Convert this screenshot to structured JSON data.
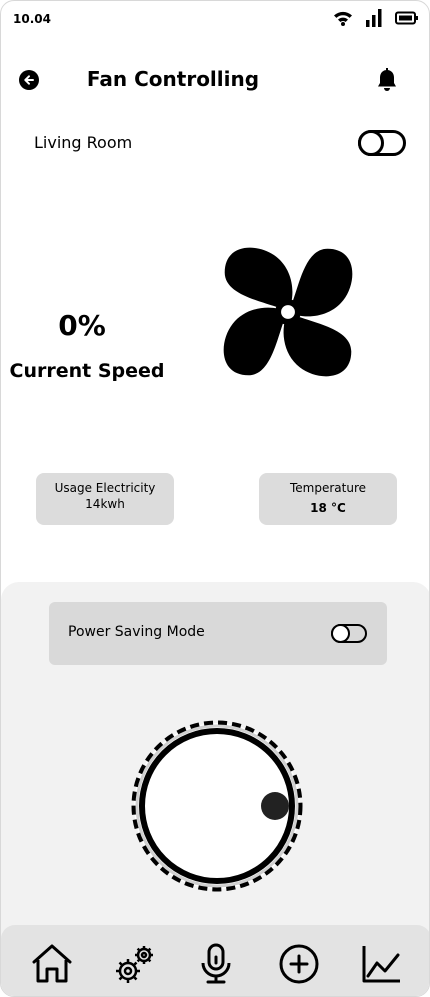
{
  "status_bar": {
    "time": "10.04",
    "icons": [
      "wifi-icon",
      "signal-icon",
      "battery-icon"
    ]
  },
  "header": {
    "title": "Fan Controlling",
    "back_icon": "back-arrow-icon",
    "notification_icon": "bell-icon"
  },
  "room": {
    "name": "Living Room",
    "power_on": false
  },
  "fan": {
    "speed": "0%",
    "speed_label": "Current Speed",
    "icon": "fan-icon"
  },
  "stats": {
    "electricity": {
      "label": "Usage Electricity",
      "value": "14kwh"
    },
    "temperature": {
      "label": "Temperature",
      "value": "18",
      "unit": "°C"
    }
  },
  "power_saving": {
    "label": "Power Saving Mode",
    "enabled": false
  },
  "speed_dial": {
    "value": 0
  },
  "nav": {
    "items": [
      {
        "name": "home",
        "icon": "home-icon"
      },
      {
        "name": "settings",
        "icon": "gear-icon"
      },
      {
        "name": "voice",
        "icon": "microphone-icon"
      },
      {
        "name": "add",
        "icon": "plus-circle-icon"
      },
      {
        "name": "statistics",
        "icon": "chart-icon"
      }
    ]
  },
  "colors": {
    "accent": "#000000",
    "panel": "#f2f2f2",
    "card": "#dcdcdc",
    "nav": "#e3e3e3"
  }
}
